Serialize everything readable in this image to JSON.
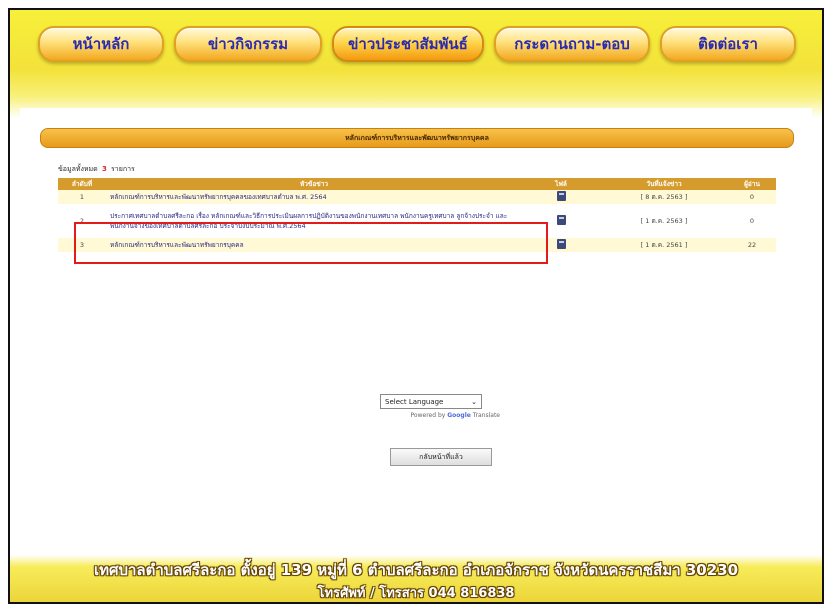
{
  "nav": {
    "items": [
      "หน้าหลัก",
      "ข่าวกิจกรรม",
      "ข่าวประชาสัมพันธ์",
      "กระดานถาม-ตอบ",
      "ติดต่อเรา"
    ],
    "active_index": 2
  },
  "section": {
    "title": "หลักเกณฑ์การบริหารและพัฒนาทรัพยากรบุคคล"
  },
  "count": {
    "label": "ข้อมูลทั้งหมด",
    "value": "3",
    "unit": "รายการ"
  },
  "table": {
    "headers": [
      "ลำดับที่",
      "หัวข้อข่าว",
      "ไฟล์",
      "วันที่แจ้งข่าว",
      "ผู้อ่าน"
    ],
    "rows": [
      {
        "no": "1",
        "title": "หลักเกณฑ์การบริหารและพัฒนาทรัพยากรบุคคลของเทศบาลตำบล พ.ศ. 2564",
        "date": "[ 8 ต.ค. 2563 ]",
        "views": "0"
      },
      {
        "no": "2",
        "title": "ประกาศเทศบาลตำบลศรีละกอ เรื่อง หลักเกณฑ์และวิธีการประเมินผลการปฏิบัติงานของพนักงานเทศบาล พนักงานครูเทศบาล ลูกจ้างประจำ และพนักงานจ้างของเทศบาลตำบลศรีละกอ ประจำปีงบประมาณ พ.ศ.2564",
        "date": "[ 1 ต.ค. 2563 ]",
        "views": "0"
      },
      {
        "no": "3",
        "title": "หลักเกณฑ์การบริหารและพัฒนาทรัพยากรบุคคล",
        "date": "[ 1 ต.ค. 2561 ]",
        "views": "22"
      }
    ]
  },
  "translate": {
    "select_label": "Select Language",
    "powered_by": "Powered by",
    "google": "Google",
    "translate": "Translate"
  },
  "back_button": "กลับหน้าที่แล้ว",
  "footer": {
    "address": "เทศบาลตำบลศรีละกอ ตั้งอยู่ 139 หมู่ที่ 6 ตำบลศรีละกอ อำเภอจักราช จังหวัดนครราชสีมา 30230",
    "phone": "โทรศัพท์ / โทรสาร 044 816838"
  },
  "colors": {
    "banner": "#f3e23a",
    "tab_text": "#2a2ab3",
    "table_header": "#d59b2c",
    "highlight": "#e31b1b"
  }
}
